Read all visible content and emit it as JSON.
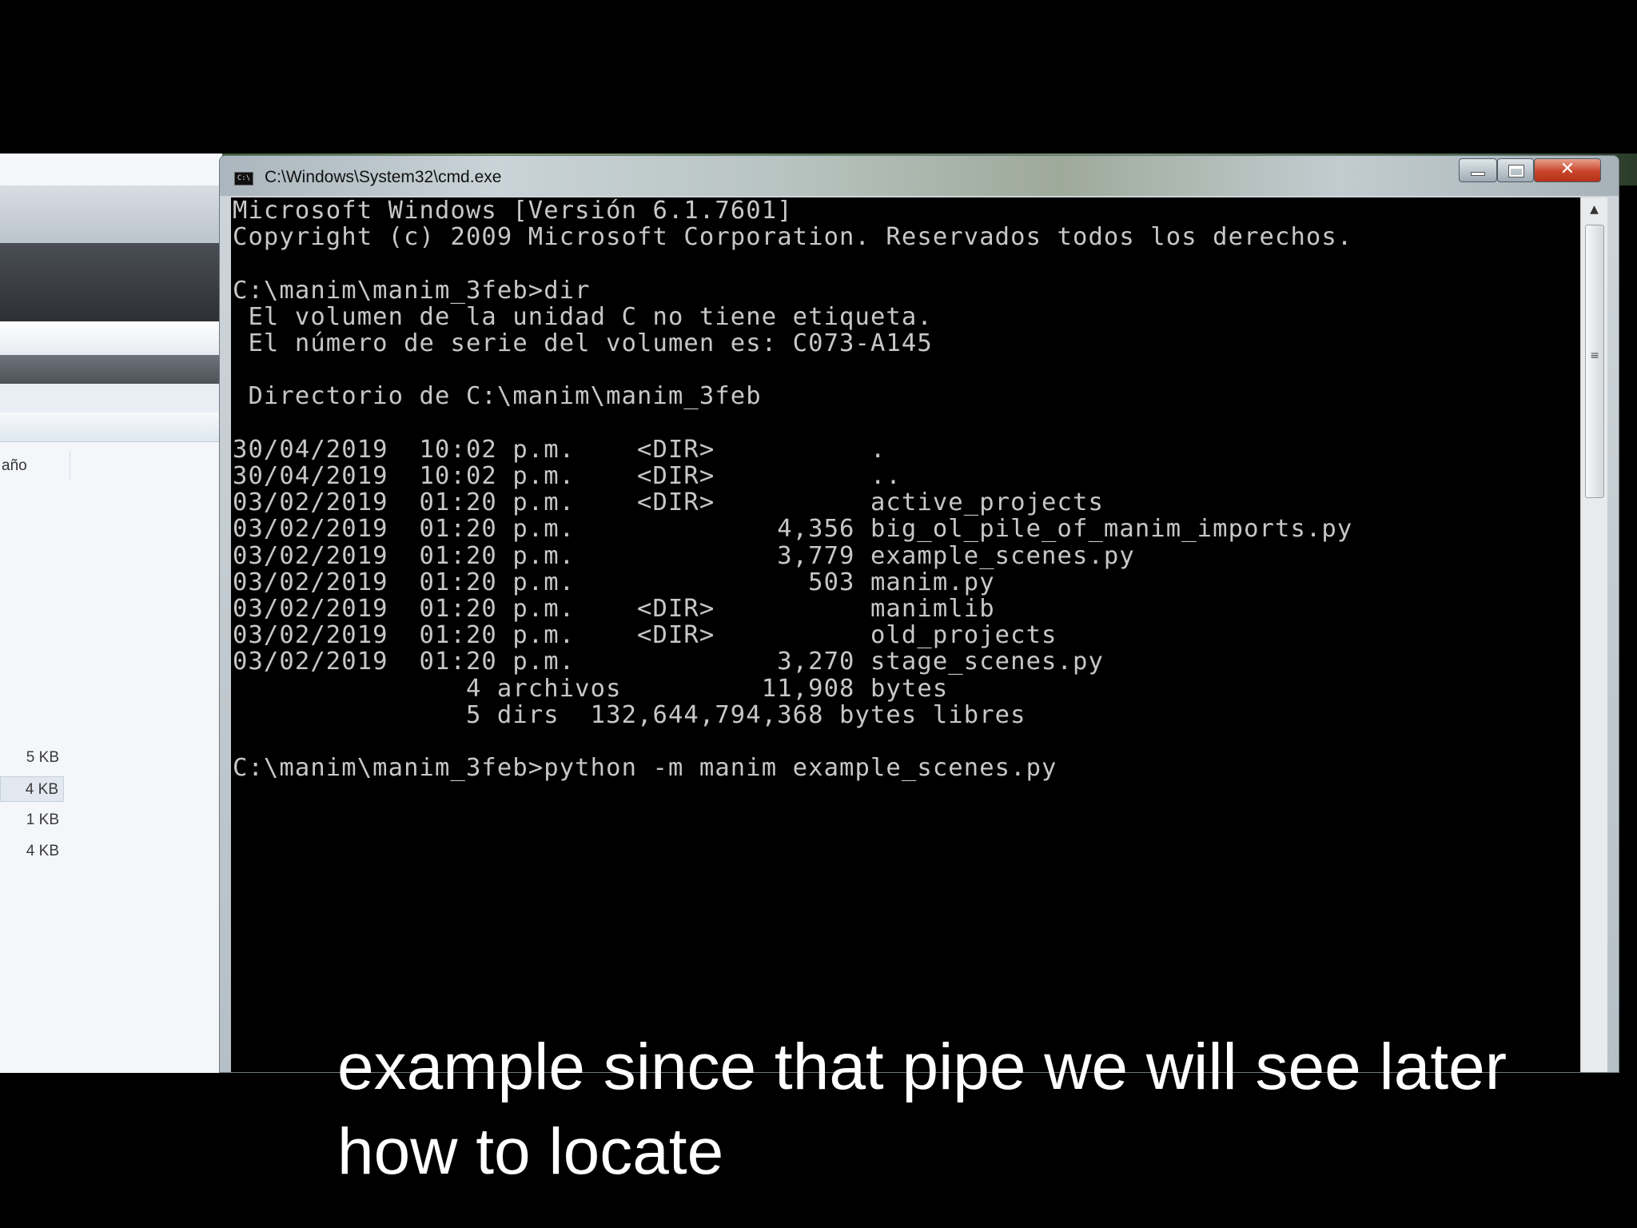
{
  "cmd": {
    "title": "C:\\Windows\\System32\\cmd.exe",
    "icon": "cmd-icon",
    "icon_glyph": "C:\\",
    "close_glyph": "✕",
    "lines": [
      "Microsoft Windows [Versión 6.1.7601]",
      "Copyright (c) 2009 Microsoft Corporation. Reservados todos los derechos.",
      "",
      "C:\\manim\\manim_3feb>dir",
      " El volumen de la unidad C no tiene etiqueta.",
      " El número de serie del volumen es: C073-A145",
      "",
      " Directorio de C:\\manim\\manim_3feb",
      "",
      "30/04/2019  10:02 p.m.    <DIR>          .",
      "30/04/2019  10:02 p.m.    <DIR>          ..",
      "03/02/2019  01:20 p.m.    <DIR>          active_projects",
      "03/02/2019  01:20 p.m.             4,356 big_ol_pile_of_manim_imports.py",
      "03/02/2019  01:20 p.m.             3,779 example_scenes.py",
      "03/02/2019  01:20 p.m.               503 manim.py",
      "03/02/2019  01:20 p.m.    <DIR>          manimlib",
      "03/02/2019  01:20 p.m.    <DIR>          old_projects",
      "03/02/2019  01:20 p.m.             3,270 stage_scenes.py",
      "               4 archivos         11,908 bytes",
      "               5 dirs  132,644,794,368 bytes libres",
      "",
      "C:\\manim\\manim_3feb>python -m manim example_scenes.py"
    ]
  },
  "explorer": {
    "column_header": "año",
    "sizes": [
      "5 KB",
      "4 KB",
      "1 KB",
      "4 KB"
    ]
  },
  "caption": {
    "text": "example since that pipe we will see later how to locate"
  }
}
